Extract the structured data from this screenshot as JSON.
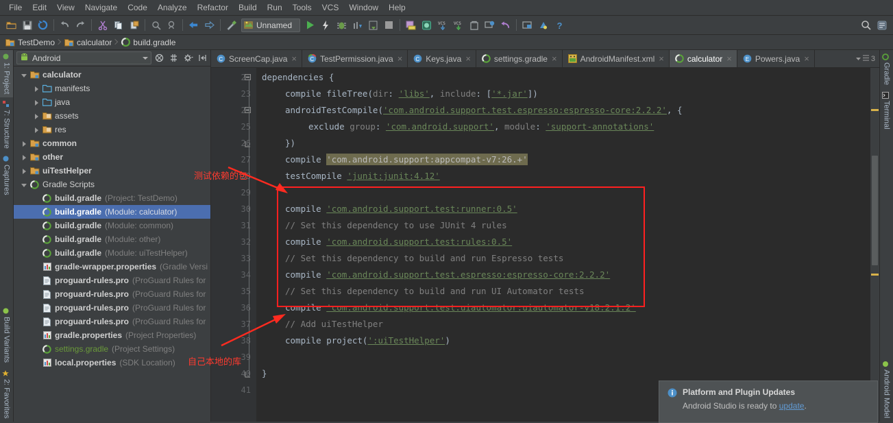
{
  "menubar": {
    "items": [
      "File",
      "Edit",
      "View",
      "Navigate",
      "Code",
      "Analyze",
      "Refactor",
      "Build",
      "Run",
      "Tools",
      "VCS",
      "Window",
      "Help"
    ]
  },
  "toolbar": {
    "run_config": "Unnamed",
    "icons": [
      "open-project-icon",
      "save-all-icon",
      "sync-icon",
      "undo-icon",
      "redo-icon",
      "cut-icon",
      "copy-icon",
      "paste-icon",
      "find-icon",
      "find-usages-icon",
      "back-icon",
      "forward-icon",
      "build-hammer-icon",
      "run-config-icon",
      "run-icon",
      "apply-changes-icon",
      "debug-icon",
      "profile-icon",
      "attach-debugger-icon",
      "stop-icon",
      "sdk-manager-icon",
      "avd-manager-icon",
      "vcs-update-icon",
      "vcs-commit-icon",
      "layout-inspector-icon",
      "monitor-icon",
      "revert-icon",
      "project-structure-icon",
      "settings-icon",
      "help-icon"
    ],
    "search_icon": "search-icon",
    "more_icon": "more-icon"
  },
  "breadcrumb": {
    "items": [
      {
        "label": "TestDemo",
        "icon": "module-folder-icon"
      },
      {
        "label": "calculator",
        "icon": "module-folder-icon"
      },
      {
        "label": "build.gradle",
        "icon": "gradle-icon"
      }
    ]
  },
  "left_strip": {
    "top": [
      {
        "label": "1: Project",
        "icon": "project-icon",
        "selected": true
      },
      {
        "label": "7: Structure",
        "icon": "structure-icon",
        "selected": false
      },
      {
        "label": "Captures",
        "icon": "captures-icon",
        "selected": false
      }
    ],
    "bottom": [
      {
        "label": "Build Variants",
        "icon": "build-variants-icon",
        "selected": false
      },
      {
        "label": "2: Favorites",
        "icon": "favorites-star-icon",
        "selected": false
      }
    ]
  },
  "right_strip": {
    "top": [
      {
        "label": "Gradle",
        "icon": "gradle-icon",
        "selected": false
      },
      {
        "label": "Terminal",
        "icon": "terminal-icon",
        "selected": false
      }
    ],
    "bottom": [
      {
        "label": "Android Model",
        "icon": "android-model-icon",
        "selected": false
      }
    ]
  },
  "project_panel": {
    "scope": "Android",
    "scope_icon": "android-head-icon",
    "buttons": [
      "collapse-all-icon",
      "expand-all-icon",
      "settings-gear-icon",
      "hide-panel-icon"
    ],
    "tree": [
      {
        "depth": 0,
        "arrow": "down",
        "icon": "module-folder-icon",
        "label": "calculator",
        "bold": true,
        "sub": "",
        "selected": false
      },
      {
        "depth": 1,
        "arrow": "right",
        "icon": "folder-icon",
        "label": "manifests",
        "bold": false,
        "sub": "",
        "selected": false
      },
      {
        "depth": 1,
        "arrow": "right",
        "icon": "folder-icon",
        "label": "java",
        "bold": false,
        "sub": "",
        "selected": false
      },
      {
        "depth": 1,
        "arrow": "right",
        "icon": "res-folder-icon",
        "label": "assets",
        "bold": false,
        "sub": "",
        "selected": false
      },
      {
        "depth": 1,
        "arrow": "right",
        "icon": "res-folder-icon",
        "label": "res",
        "bold": false,
        "sub": "",
        "selected": false
      },
      {
        "depth": 0,
        "arrow": "right",
        "icon": "module-folder-icon",
        "label": "common",
        "bold": true,
        "sub": "",
        "selected": false
      },
      {
        "depth": 0,
        "arrow": "right",
        "icon": "module-folder-icon",
        "label": "other",
        "bold": true,
        "sub": "",
        "selected": false
      },
      {
        "depth": 0,
        "arrow": "right",
        "icon": "module-folder-icon",
        "label": "uiTestHelper",
        "bold": true,
        "sub": "",
        "selected": false
      },
      {
        "depth": 0,
        "arrow": "down",
        "icon": "gradle-icon",
        "label": "Gradle Scripts",
        "bold": false,
        "sub": "",
        "selected": false
      },
      {
        "depth": 1,
        "arrow": "none",
        "icon": "gradle-icon",
        "label": "build.gradle",
        "bold": true,
        "sub": "(Project: TestDemo)",
        "selected": false
      },
      {
        "depth": 1,
        "arrow": "none",
        "icon": "gradle-icon",
        "label": "build.gradle",
        "bold": true,
        "sub": "(Module: calculator)",
        "selected": true
      },
      {
        "depth": 1,
        "arrow": "none",
        "icon": "gradle-icon",
        "label": "build.gradle",
        "bold": true,
        "sub": "(Module: common)",
        "selected": false
      },
      {
        "depth": 1,
        "arrow": "none",
        "icon": "gradle-icon",
        "label": "build.gradle",
        "bold": true,
        "sub": "(Module: other)",
        "selected": false
      },
      {
        "depth": 1,
        "arrow": "none",
        "icon": "gradle-icon",
        "label": "build.gradle",
        "bold": true,
        "sub": "(Module: uiTestHelper)",
        "selected": false
      },
      {
        "depth": 1,
        "arrow": "none",
        "icon": "properties-icon",
        "label": "gradle-wrapper.properties",
        "bold": true,
        "sub": "(Gradle Versi",
        "selected": false
      },
      {
        "depth": 1,
        "arrow": "none",
        "icon": "file-icon",
        "label": "proguard-rules.pro",
        "bold": true,
        "sub": "(ProGuard Rules for",
        "selected": false
      },
      {
        "depth": 1,
        "arrow": "none",
        "icon": "file-icon",
        "label": "proguard-rules.pro",
        "bold": true,
        "sub": "(ProGuard Rules for",
        "selected": false
      },
      {
        "depth": 1,
        "arrow": "none",
        "icon": "file-icon",
        "label": "proguard-rules.pro",
        "bold": true,
        "sub": "(ProGuard Rules for",
        "selected": false
      },
      {
        "depth": 1,
        "arrow": "none",
        "icon": "file-icon",
        "label": "proguard-rules.pro",
        "bold": true,
        "sub": "(ProGuard Rules for",
        "selected": false
      },
      {
        "depth": 1,
        "arrow": "none",
        "icon": "properties-icon",
        "label": "gradle.properties",
        "bold": true,
        "sub": "(Project Properties)",
        "selected": false
      },
      {
        "depth": 1,
        "arrow": "none",
        "icon": "gradle-icon",
        "label": "settings.gradle",
        "bold": false,
        "green": true,
        "sub": "(Project Settings)",
        "selected": false
      },
      {
        "depth": 1,
        "arrow": "none",
        "icon": "properties-icon",
        "label": "local.properties",
        "bold": true,
        "sub": "(SDK Location)",
        "selected": false
      }
    ]
  },
  "editor": {
    "tabs": [
      {
        "label": "ScreenCap.java",
        "icon": "java-class-icon",
        "active": false,
        "closable": true
      },
      {
        "label": "TestPermission.java",
        "icon": "java-test-class-icon",
        "active": false,
        "closable": true
      },
      {
        "label": "Keys.java",
        "icon": "java-class-icon",
        "active": false,
        "closable": true
      },
      {
        "label": "settings.gradle",
        "icon": "gradle-icon",
        "active": false,
        "closable": true
      },
      {
        "label": "AndroidManifest.xml",
        "icon": "android-manifest-icon",
        "active": false,
        "closable": true
      },
      {
        "label": "calculator",
        "icon": "gradle-icon",
        "active": true,
        "closable": true
      },
      {
        "label": "Powers.java",
        "icon": "java-enum-icon",
        "active": false,
        "closable": true
      }
    ],
    "tab_overflow_label": "3",
    "first_line_number": 22,
    "lines": [
      {
        "n": 22,
        "fold": "open",
        "tokens": [
          {
            "t": "dependencies {",
            "c": "pl"
          }
        ],
        "indent": 0
      },
      {
        "n": 23,
        "fold": "",
        "tokens": [
          {
            "t": "compile ",
            "c": "pl"
          },
          {
            "t": "fileTree",
            "c": "fn"
          },
          {
            "t": "(",
            "c": "pl"
          },
          {
            "t": "dir",
            "c": "cm"
          },
          {
            "t": ": ",
            "c": "pl"
          },
          {
            "t": "'libs'",
            "c": "s-u"
          },
          {
            "t": ", ",
            "c": "pl"
          },
          {
            "t": "include",
            "c": "cm"
          },
          {
            "t": ": [",
            "c": "pl"
          },
          {
            "t": "'*.jar'",
            "c": "s-u"
          },
          {
            "t": "])",
            "c": "pl"
          }
        ],
        "indent": 1
      },
      {
        "n": 24,
        "fold": "open",
        "tokens": [
          {
            "t": "androidTestCompile",
            "c": "pl"
          },
          {
            "t": "(",
            "c": "pl"
          },
          {
            "t": "'com.android.support.test.espresso:espresso-core:2.2.2'",
            "c": "s-u"
          },
          {
            "t": ", {",
            "c": "pl"
          }
        ],
        "indent": 1
      },
      {
        "n": 25,
        "fold": "",
        "tokens": [
          {
            "t": "exclude ",
            "c": "pl"
          },
          {
            "t": "group",
            "c": "cm"
          },
          {
            "t": ": ",
            "c": "pl"
          },
          {
            "t": "'com.android.support'",
            "c": "s-u"
          },
          {
            "t": ", ",
            "c": "pl"
          },
          {
            "t": "module",
            "c": "cm"
          },
          {
            "t": ": ",
            "c": "pl"
          },
          {
            "t": "'support-annotations'",
            "c": "s-u"
          }
        ],
        "indent": 2
      },
      {
        "n": 26,
        "fold": "close",
        "tokens": [
          {
            "t": "})",
            "c": "pl"
          }
        ],
        "indent": 1
      },
      {
        "n": 27,
        "fold": "",
        "tokens": [
          {
            "t": "compile ",
            "c": "pl"
          },
          {
            "t": "'com.android.support:appcompat-v7:26.+'",
            "c": "hl"
          }
        ],
        "indent": 1
      },
      {
        "n": 28,
        "fold": "",
        "tokens": [
          {
            "t": "testCompile ",
            "c": "pl"
          },
          {
            "t": "'junit:junit:4.12'",
            "c": "s-u"
          }
        ],
        "indent": 1
      },
      {
        "n": 29,
        "fold": "",
        "tokens": [],
        "indent": 1
      },
      {
        "n": 30,
        "fold": "",
        "tokens": [
          {
            "t": "compile ",
            "c": "pl"
          },
          {
            "t": "'com.android.support.test:runner:0.5'",
            "c": "s-u"
          }
        ],
        "indent": 1
      },
      {
        "n": 31,
        "fold": "",
        "tokens": [
          {
            "t": "// Set this dependency to use JUnit 4 rules",
            "c": "cm"
          }
        ],
        "indent": 1
      },
      {
        "n": 32,
        "fold": "",
        "tokens": [
          {
            "t": "compile ",
            "c": "pl"
          },
          {
            "t": "'com.android.support.test:rules:0.5'",
            "c": "s-u"
          }
        ],
        "indent": 1
      },
      {
        "n": 33,
        "fold": "",
        "tokens": [
          {
            "t": "// Set this dependency to build and run Espresso tests",
            "c": "cm"
          }
        ],
        "indent": 1
      },
      {
        "n": 34,
        "fold": "",
        "tokens": [
          {
            "t": "compile ",
            "c": "pl"
          },
          {
            "t": "'com.android.support.test.espresso:espresso-core:2.2.2'",
            "c": "s-u"
          }
        ],
        "indent": 1
      },
      {
        "n": 35,
        "fold": "",
        "tokens": [
          {
            "t": "// Set this dependency to build and run UI Automator tests",
            "c": "cm"
          }
        ],
        "indent": 1
      },
      {
        "n": 36,
        "fold": "",
        "tokens": [
          {
            "t": "compile ",
            "c": "pl"
          },
          {
            "t": "'com.android.support.test.uiautomator:uiautomator-v18:2.1.2'",
            "c": "s-u"
          }
        ],
        "indent": 1
      },
      {
        "n": 37,
        "fold": "",
        "tokens": [
          {
            "t": "// Add uiTestHelper",
            "c": "cm"
          }
        ],
        "indent": 1
      },
      {
        "n": 38,
        "fold": "",
        "tokens": [
          {
            "t": "compile ",
            "c": "pl"
          },
          {
            "t": "project",
            "c": "fn"
          },
          {
            "t": "(",
            "c": "pl"
          },
          {
            "t": "':uiTestHelper'",
            "c": "s-u"
          },
          {
            "t": ")",
            "c": "pl"
          }
        ],
        "indent": 1
      },
      {
        "n": 39,
        "fold": "",
        "tokens": [],
        "indent": 1
      },
      {
        "n": 40,
        "fold": "close",
        "tokens": [
          {
            "t": "}",
            "c": "pl"
          }
        ],
        "indent": 0
      },
      {
        "n": 41,
        "fold": "",
        "tokens": [],
        "indent": 0
      }
    ]
  },
  "annotations": [
    {
      "text": "测试依赖的包",
      "name": "annotation-test-dependencies"
    },
    {
      "text": "自己本地的库",
      "name": "annotation-local-library"
    }
  ],
  "notification": {
    "title": "Platform and Plugin Updates",
    "text_before": "Android Studio is ready to ",
    "link": "update",
    "text_after": ".",
    "icon": "info-icon"
  },
  "colors": {
    "accent_selection": "#4b6eaf",
    "annotation_red": "#ff3b30",
    "link_blue": "#629bd4",
    "string_green": "#6a8759",
    "comment_gray": "#808080",
    "editor_bg": "#2b2b2b",
    "chrome_bg": "#3c3f41"
  }
}
